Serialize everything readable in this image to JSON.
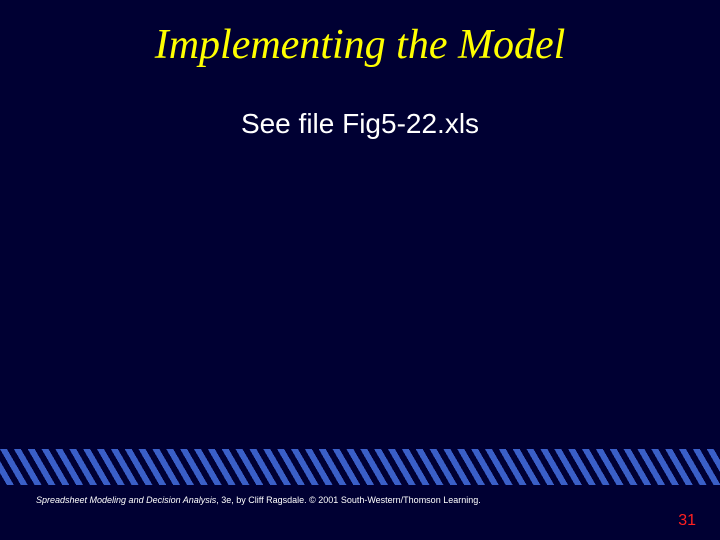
{
  "title": "Implementing the Model",
  "body": "See file Fig5-22.xls",
  "citation": {
    "book_title": "Spreadsheet Modeling and Decision Analysis",
    "rest": ", 3e, by Cliff Ragsdale. © 2001 South-Western/Thomson Learning."
  },
  "slide_number": "31"
}
